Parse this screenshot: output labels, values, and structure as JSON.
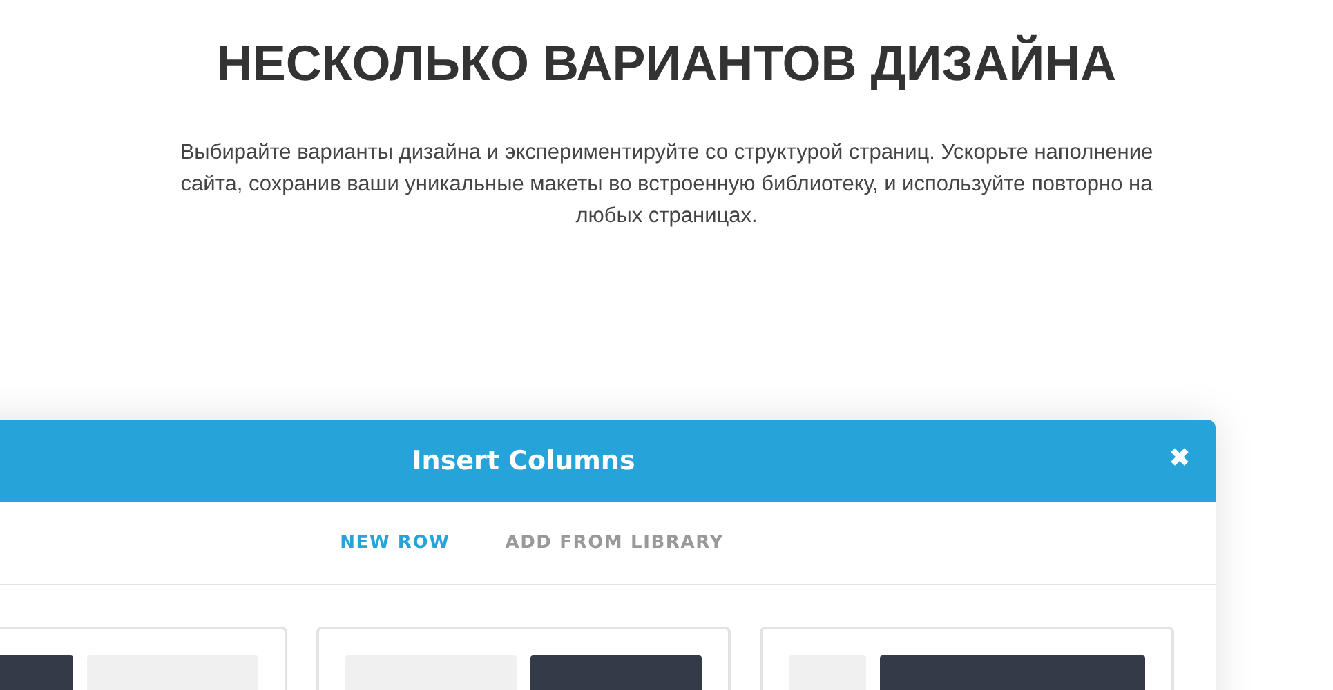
{
  "heading": "НЕСКОЛЬКО ВАРИАНТОВ ДИЗАЙНА",
  "description": "Выбирайте варианты дизайна и экспериментируйте со структурой страниц. Ускорьте наполнение сайта, сохранив ваши уникальные макеты во встроенную библиотеку, и используйте повторно на любых страницах.",
  "modal": {
    "title": "Insert Columns",
    "close_icon": "✖",
    "tabs": [
      {
        "label": "NEW ROW",
        "selected": true
      },
      {
        "label": "ADD FROM LIBRARY",
        "selected": false
      }
    ],
    "layouts": [
      {
        "kind": "halves",
        "columns": [
          {
            "selected": true
          },
          {
            "selected": false
          }
        ]
      },
      {
        "kind": "halves",
        "columns": [
          {
            "selected": false
          },
          {
            "selected": true
          }
        ]
      },
      {
        "kind": "quarter-rest",
        "columns": [
          {
            "selected": false
          },
          {
            "selected": true
          }
        ]
      }
    ]
  }
}
